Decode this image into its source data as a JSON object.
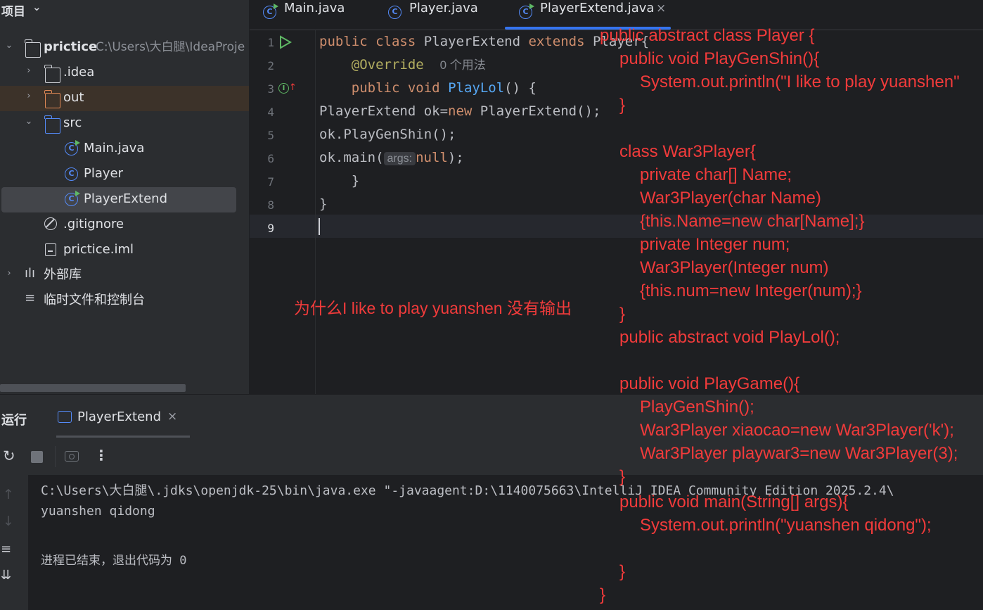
{
  "project": {
    "header": "项目",
    "tree": [
      {
        "key": "root",
        "label": "prictice",
        "path": "C:\\Users\\大白腿\\IdeaProje"
      },
      {
        "key": "idea",
        "label": ".idea"
      },
      {
        "key": "out",
        "label": "out"
      },
      {
        "key": "src",
        "label": "src"
      },
      {
        "key": "main",
        "label": "Main.java"
      },
      {
        "key": "player",
        "label": "Player"
      },
      {
        "key": "playerextend",
        "label": "PlayerExtend"
      },
      {
        "key": "gitignore",
        "label": ".gitignore"
      },
      {
        "key": "iml",
        "label": "prictice.iml"
      },
      {
        "key": "libs",
        "label": "外部库"
      },
      {
        "key": "scratch",
        "label": "临时文件和控制台"
      }
    ]
  },
  "tabs": [
    "Main.java",
    "Player.java",
    "PlayerExtend.java"
  ],
  "editor": {
    "line_numbers": [
      "1",
      "2",
      "3",
      "4",
      "5",
      "6",
      "7",
      "8",
      "9"
    ],
    "usages_hint": "0 个用法",
    "param_hint": "args:",
    "lines": {
      "l1_kw1": "public",
      "l1_kw2": "class",
      "l1_name": "PlayerExtend",
      "l1_kw3": "extends",
      "l1_sup": "Player{",
      "l2_ann": "@Override",
      "l3_kw1": "public",
      "l3_kw2": "void",
      "l3_fn": "PlayLol",
      "l3_rest": "() {",
      "l4_a": "PlayerExtend ok=",
      "l4_kw": "new",
      "l4_b": " PlayerExtend();",
      "l5": "ok.PlayGenShin();",
      "l6_a": "ok.main(",
      "l6_kw": "null",
      "l6_b": ");",
      "l7": "}",
      "l8": "}"
    }
  },
  "run": {
    "title": "运行",
    "tab_label": "PlayerExtend",
    "console": [
      "C:\\Users\\大白腿\\.jdks\\openjdk-25\\bin\\java.exe \"-javaagent:D:\\1140075663\\IntelliJ IDEA Community Edition 2025.2.4\\",
      "yuanshen qidong",
      "进程已结束，退出代码为 0"
    ]
  },
  "overlay": {
    "question": "为什么I like to play yuanshen 没有输出",
    "code": [
      "public abstract class Player {",
      "public void PlayGenShin(){",
      "System.out.println(\"I like to play yuanshen\"",
      "}",
      "class War3Player{",
      "private char[] Name;",
      "War3Player(char Name)",
      "{this.Name=new char[Name];}",
      "private Integer num;",
      "War3Player(Integer num)",
      "{this.num=new Integer(num);}",
      "}",
      "public abstract void PlayLol();",
      "public void PlayGame(){",
      "PlayGenShin();",
      "War3Player xiaocao=new War3Player('k');",
      "War3Player playwar3=new War3Player(3);",
      "}",
      "public void main(String[] args){",
      "System.out.println(\"yuanshen qidong\");",
      "}",
      "}"
    ]
  },
  "colors": {
    "overlay_red": "#f23b3b",
    "accent": "#3574f0",
    "keyword": "#cf8e6d",
    "function": "#56a8f5",
    "annotation": "#b3ae60"
  }
}
